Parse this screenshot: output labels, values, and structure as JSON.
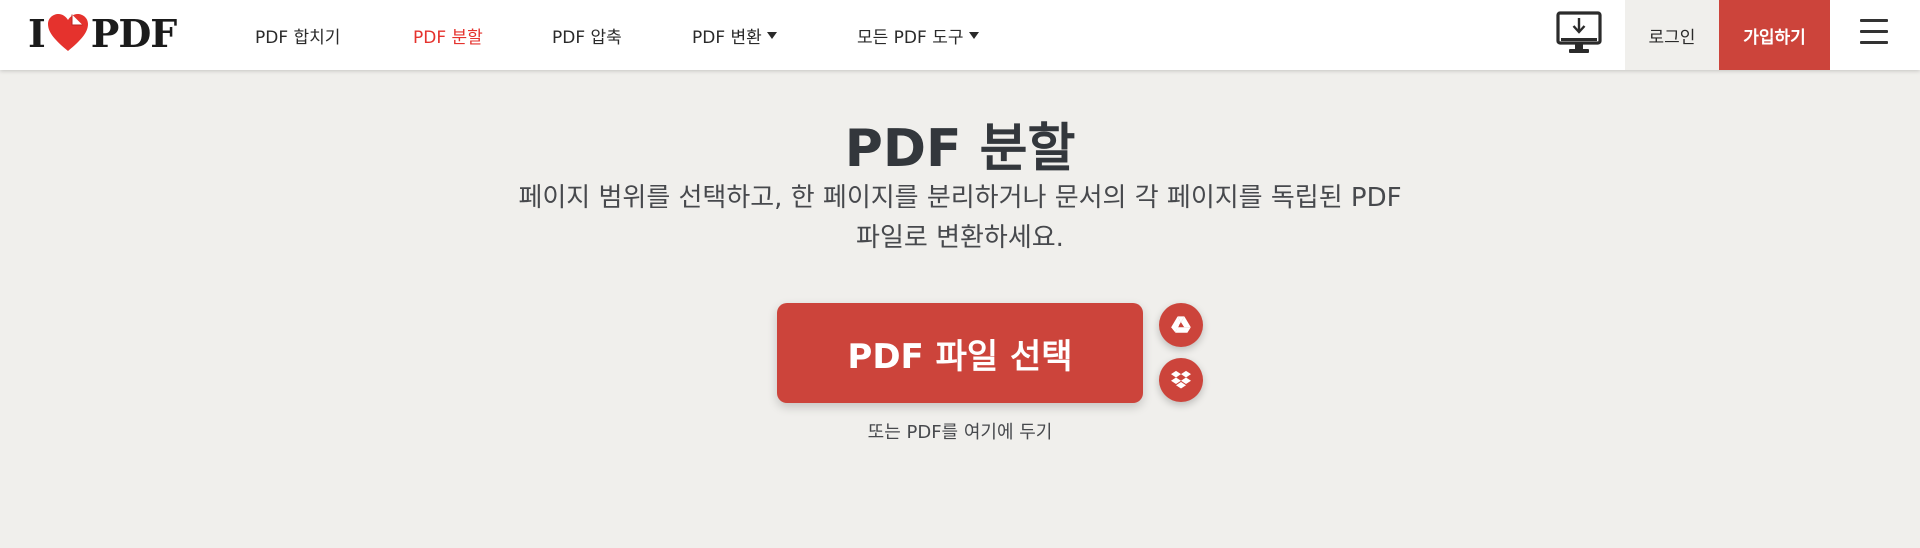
{
  "brand": {
    "logo_left": "I",
    "logo_right": "PDF",
    "accent_color": "#e5322d",
    "button_color": "#cc443b"
  },
  "nav": {
    "items": [
      {
        "label": "PDF 합치기",
        "active": false
      },
      {
        "label": "PDF 분할",
        "active": true
      },
      {
        "label": "PDF 압축",
        "active": false
      },
      {
        "label": "PDF 변환",
        "active": false,
        "dropdown": true
      },
      {
        "label": "모든 PDF 도구",
        "active": false,
        "dropdown": true
      }
    ]
  },
  "header_actions": {
    "desktop_icon": "desktop-download-icon",
    "login_label": "로그인",
    "signup_label": "가입하기",
    "menu_icon": "hamburger-menu-icon"
  },
  "main": {
    "title": "PDF 분할",
    "subtitle_line1": "페이지 범위를 선택하고, 한 페이지를 분리하거나 문서의 각 페이지를 독립된 PDF",
    "subtitle_line2": "파일로 변환하세요.",
    "select_button_label": "PDF 파일 선택",
    "google_drive_icon": "google-drive-icon",
    "dropbox_icon": "dropbox-icon",
    "drop_hint": "또는 PDF를 여기에 두기"
  }
}
